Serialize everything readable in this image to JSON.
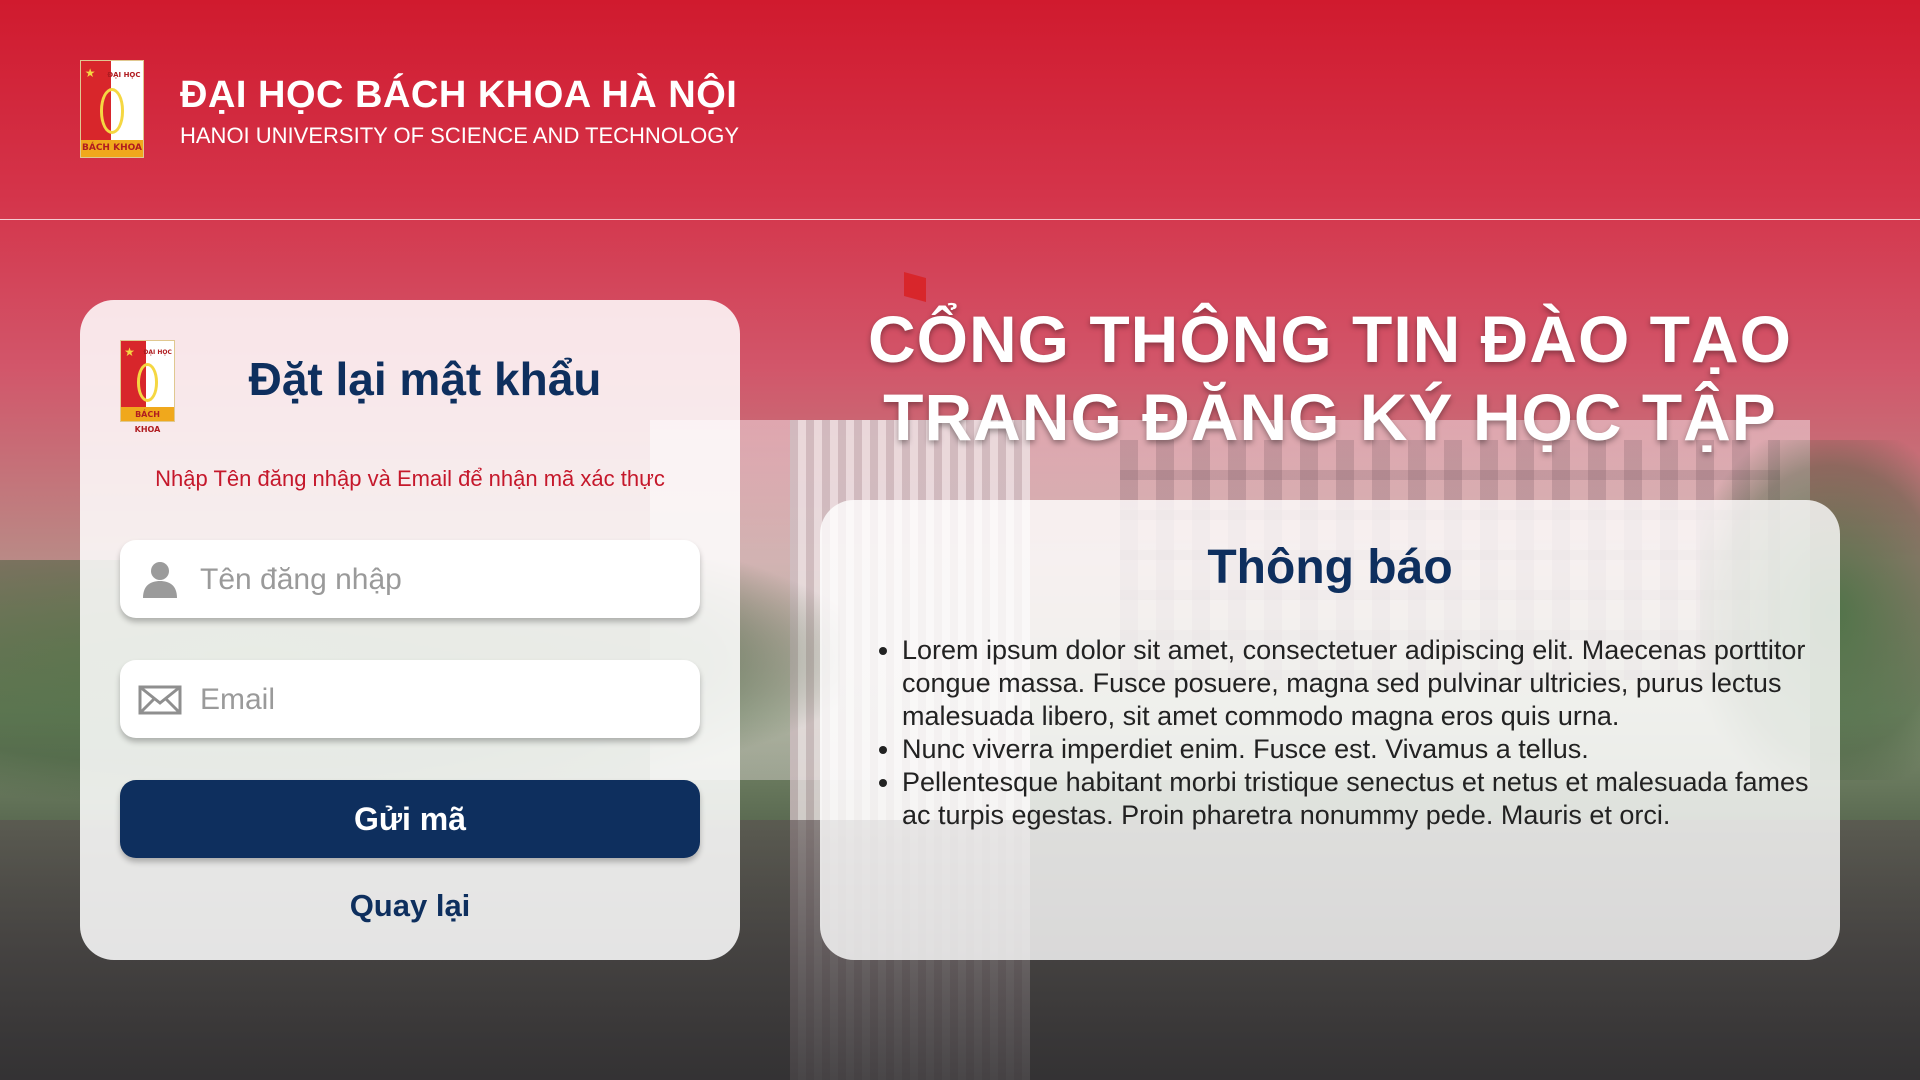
{
  "header": {
    "title": "ĐẠI HỌC BÁCH KHOA HÀ NỘI",
    "subtitle": "HANOI UNIVERSITY OF SCIENCE AND TECHNOLOGY",
    "logo": {
      "top_label": "ĐẠI HỌC",
      "bottom_label": "BÁCH KHOA",
      "icon": "star-icon"
    }
  },
  "colors": {
    "brand_red": "#d01a2e",
    "brand_navy": "#0e2f5e",
    "hint_red": "#c5182b",
    "logo_gold": "#f0a81c"
  },
  "reset_form": {
    "logo": {
      "top_label": "ĐẠI HỌC",
      "bottom_label": "BÁCH KHOA"
    },
    "title": "Đặt lại mật khẩu",
    "hint": "Nhập Tên đăng nhập và Email để nhận mã xác thực",
    "username": {
      "placeholder": "Tên đăng nhập",
      "value": "",
      "icon": "user-icon"
    },
    "email": {
      "placeholder": "Email",
      "value": "",
      "icon": "envelope-icon"
    },
    "submit_label": "Gửi mã",
    "back_label": "Quay lại"
  },
  "portal": {
    "line1": "CỔNG THÔNG TIN ĐÀO TẠO",
    "line2": "TRANG ĐĂNG KÝ HỌC TẬP"
  },
  "notice": {
    "title": "Thông báo",
    "items": [
      "Lorem ipsum dolor sit amet, consectetuer adipiscing elit. Maecenas porttitor congue massa. Fusce posuere, magna sed pulvinar ultricies, purus lectus malesuada libero, sit amet commodo magna eros quis urna.",
      "Nunc viverra imperdiet enim. Fusce est. Vivamus a tellus.",
      "Pellentesque habitant morbi tristique senectus et netus et malesuada fames ac turpis egestas. Proin pharetra nonummy pede. Mauris et orci."
    ]
  }
}
